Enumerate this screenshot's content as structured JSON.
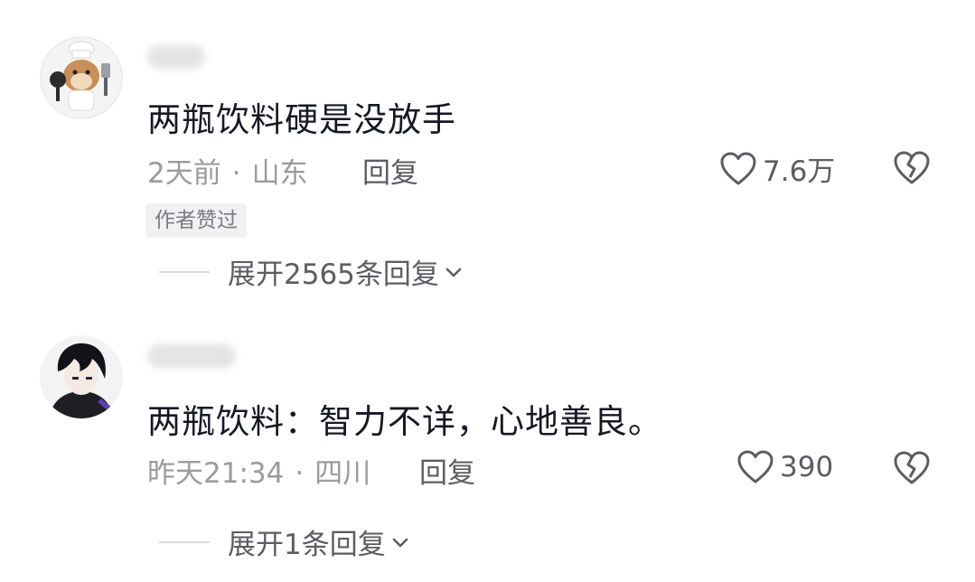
{
  "comments": [
    {
      "text": "两瓶饮料硬是没放手",
      "time": "2天前",
      "separator": "·",
      "location": "山东",
      "reply_label": "回复",
      "likes": "7.6万",
      "badge": "作者赞过",
      "expand_label": "展开2565条回复",
      "avatar_icon": "hamster-chef-avatar"
    },
    {
      "text": "两瓶饮料：智力不详，心地善良。",
      "time": "昨天21:34",
      "separator": "·",
      "location": "四川",
      "reply_label": "回复",
      "likes": "390",
      "expand_label": "展开1条回复",
      "avatar_icon": "anime-boy-avatar"
    }
  ]
}
